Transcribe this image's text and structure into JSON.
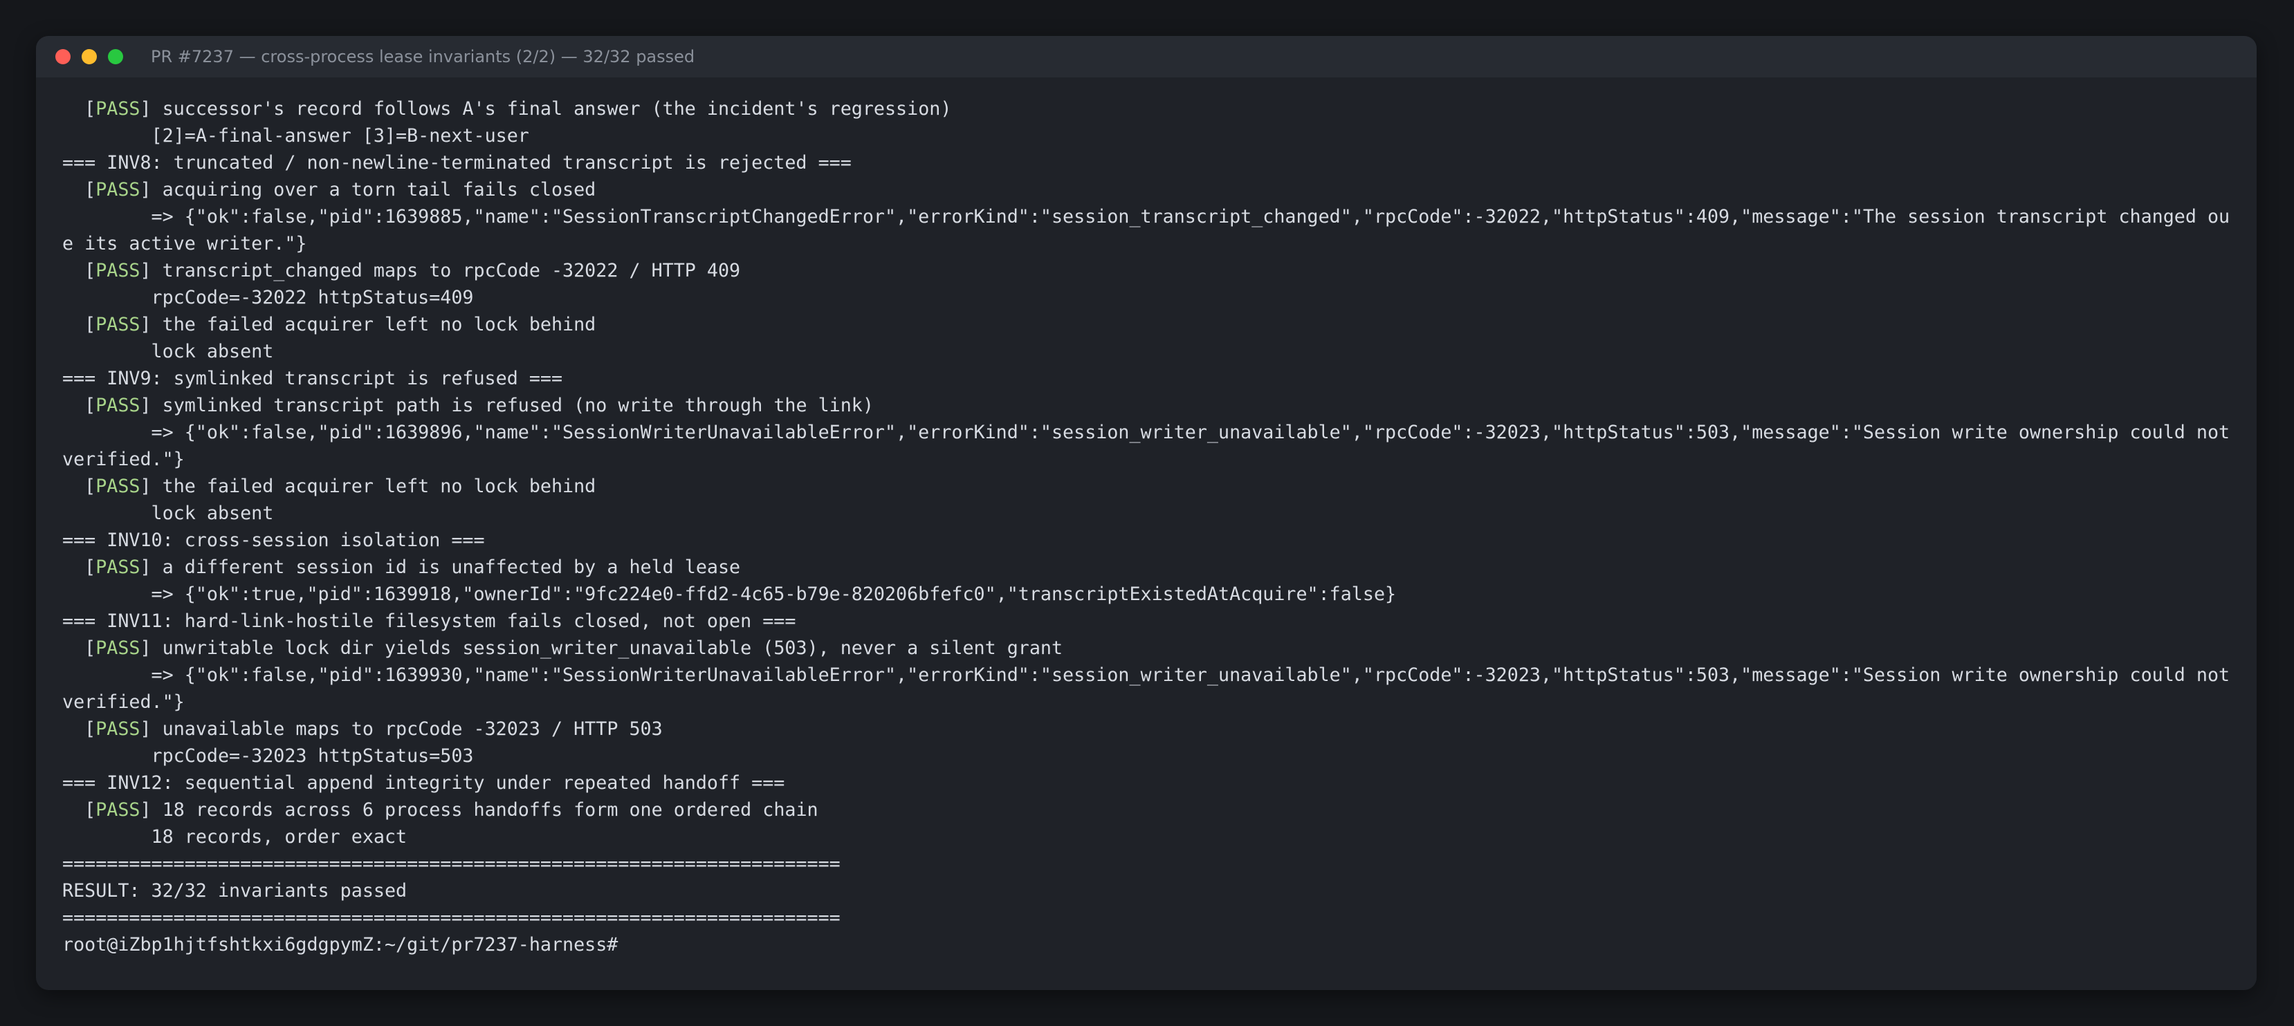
{
  "window": {
    "title": "PR #7237 — cross-process lease invariants (2/2) — 32/32 passed"
  },
  "lines": [
    {
      "k": "pass",
      "text": "successor's record follows A's final answer (the incident's regression)"
    },
    {
      "k": "detail",
      "text": "[2]=A-final-answer [3]=B-next-user"
    },
    {
      "k": "plain",
      "text": "=== INV8: truncated / non-newline-terminated transcript is rejected ==="
    },
    {
      "k": "pass",
      "text": "acquiring over a torn tail fails closed"
    },
    {
      "k": "detail",
      "text": "{\"ok\":false,\"pid\":1639885,\"name\":\"SessionTranscriptChangedError\",\"errorKind\":\"session_transcript_changed\",\"rpcCode\":-32022,\"httpStatus\":409,\"message\":\"The session transcript changed outsid"
    },
    {
      "k": "plain",
      "text": "e its active writer.\"}"
    },
    {
      "k": "pass",
      "text": "transcript_changed maps to rpcCode -32022 / HTTP 409"
    },
    {
      "k": "detail",
      "text": "rpcCode=-32022 httpStatus=409"
    },
    {
      "k": "pass",
      "text": "the failed acquirer left no lock behind"
    },
    {
      "k": "detail",
      "text": "lock absent"
    },
    {
      "k": "plain",
      "text": "=== INV9: symlinked transcript is refused ==="
    },
    {
      "k": "pass",
      "text": "symlinked transcript path is refused (no write through the link)"
    },
    {
      "k": "detail",
      "text": "=> {\"ok\":false,\"pid\":1639896,\"name\":\"SessionWriterUnavailableError\",\"errorKind\":\"session_writer_unavailable\",\"rpcCode\":-32023,\"httpStatus\":503,\"message\":\"Session write ownership could not be"
    },
    {
      "k": "plain",
      "text": "verified.\"}"
    },
    {
      "k": "pass",
      "text": "the failed acquirer left no lock behind"
    },
    {
      "k": "detail",
      "text": "lock absent"
    },
    {
      "k": "plain",
      "text": "=== INV10: cross-session isolation ==="
    },
    {
      "k": "pass",
      "text": "a different session id is unaffected by a held lease"
    },
    {
      "k": "detail",
      "text": "=> {\"ok\":true,\"pid\":1639918,\"ownerId\":\"9fc224e0-ffd2-4c65-b79e-820206bfefc0\",\"transcriptExistedAtAcquire\":false}"
    },
    {
      "k": "plain",
      "text": "=== INV11: hard-link-hostile filesystem fails closed, not open ==="
    },
    {
      "k": "pass",
      "text": "unwritable lock dir yields session_writer_unavailable (503), never a silent grant"
    },
    {
      "k": "detail",
      "text": "=> {\"ok\":false,\"pid\":1639930,\"name\":\"SessionWriterUnavailableError\",\"errorKind\":\"session_writer_unavailable\",\"rpcCode\":-32023,\"httpStatus\":503,\"message\":\"Session write ownership could not be"
    },
    {
      "k": "plain",
      "text": "verified.\"}"
    },
    {
      "k": "pass",
      "text": "unavailable maps to rpcCode -32023 / HTTP 503"
    },
    {
      "k": "detail",
      "text": "rpcCode=-32023 httpStatus=503"
    },
    {
      "k": "plain",
      "text": "=== INV12: sequential append integrity under repeated handoff ==="
    },
    {
      "k": "pass",
      "text": "18 records across 6 process handoffs form one ordered chain"
    },
    {
      "k": "detail",
      "text": "18 records, order exact"
    },
    {
      "k": "plain",
      "text": "======================================================================"
    },
    {
      "k": "plain",
      "text": "RESULT: 32/32 invariants passed"
    },
    {
      "k": "plain",
      "text": "======================================================================"
    },
    {
      "k": "prompt",
      "text": "root@iZbp1hjtfshtkxi6gdgpymZ:~/git/pr7237-harness#"
    }
  ],
  "labels": {
    "pass": "PASS",
    "detail_prefix_inv8": "=> "
  },
  "colors": {
    "pass": "#a8d48a",
    "text": "#d7dbe2",
    "background": "#1f2228",
    "titlebar": "#272b32"
  }
}
